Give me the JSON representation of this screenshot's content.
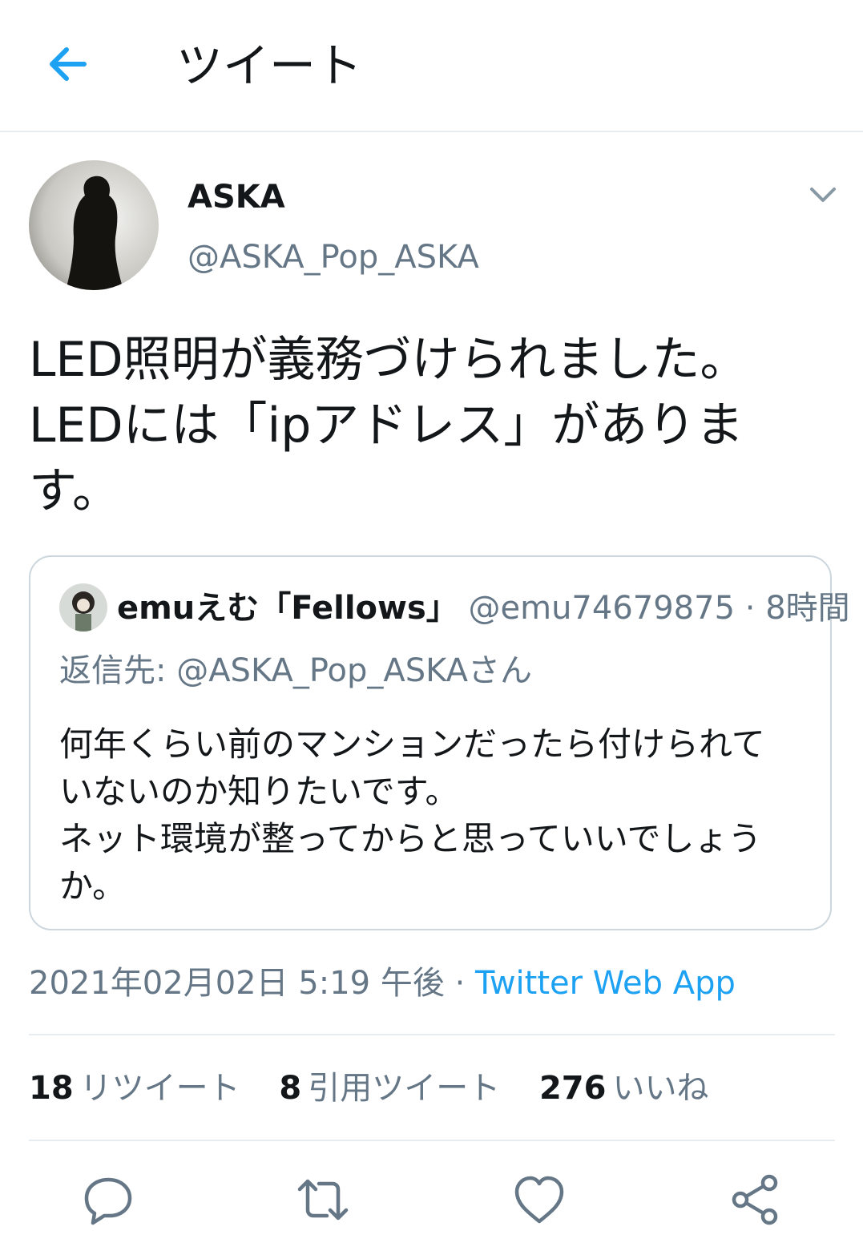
{
  "header": {
    "title": "ツイート",
    "back_icon": "arrow-left-icon"
  },
  "colors": {
    "accent": "#1da1f2",
    "text": "#14171a",
    "muted": "#657786",
    "border": "#e6ecf0"
  },
  "tweet": {
    "display_name": "ASKA",
    "handle": "@ASKA_Pop_ASKA",
    "text": "LED照明が義務づけられました。\nLEDには「ipアドレス」がありま\nす。",
    "quoted": {
      "display_name": "emuえむ「Fellows」",
      "handle": "@emu74679875",
      "separator": "·",
      "time": "8時間",
      "reply_to": "返信先: @ASKA_Pop_ASKAさん",
      "text": "何年くらい前のマンションだったら付けられて\nいないのか知りたいです。\nネット環境が整ってからと思っていいでしょう\nか。"
    },
    "timestamp": "2021年02月02日 5:19 午後",
    "meta_separator": "·",
    "source": "Twitter Web App",
    "stats": {
      "retweets": {
        "count": "18",
        "label": "リツイート"
      },
      "quotes": {
        "count": "8",
        "label": "引用ツイート"
      },
      "likes": {
        "count": "276",
        "label": "いいね"
      }
    }
  },
  "actions": [
    "reply-icon",
    "retweet-icon",
    "like-icon",
    "share-icon"
  ]
}
